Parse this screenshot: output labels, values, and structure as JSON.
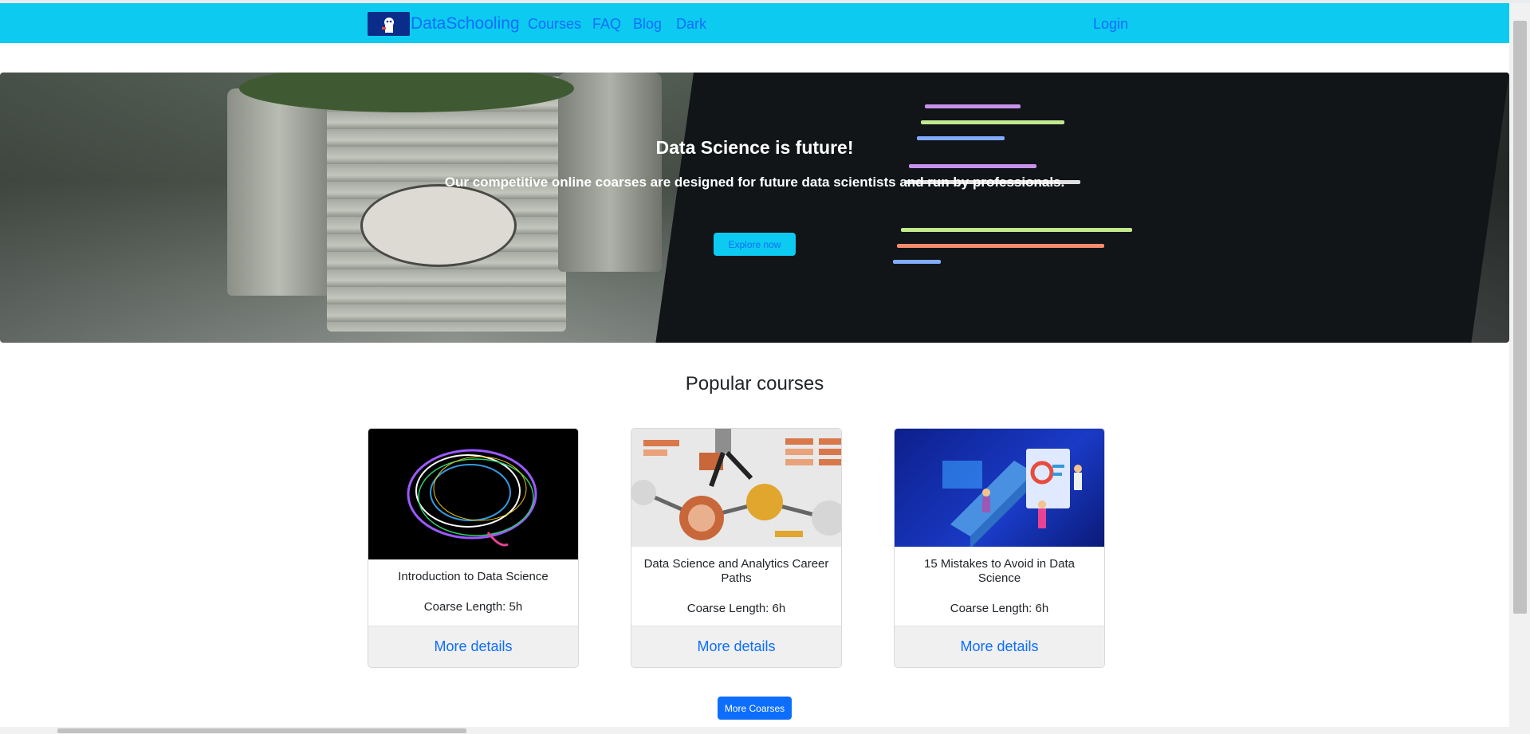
{
  "navbar": {
    "brand": "DataSchooling",
    "links": [
      "Courses",
      "FAQ",
      "Blog",
      "Dark"
    ],
    "login": "Login",
    "bg_color": "#0dcaf0",
    "link_color": "#0d6efd"
  },
  "hero": {
    "title": "Data Science is future!",
    "subtitle": "Our competitive online coarses are designed for future data scientists and run by professionals.",
    "button": "Explore now"
  },
  "popular": {
    "title": "Popular courses",
    "courses": [
      {
        "title": "Introduction to Data Science",
        "length": "Coarse Length: 5h",
        "link": "More details",
        "image": "brain-network-image"
      },
      {
        "title": "Data Science and Analytics Career Paths",
        "length": "Coarse Length: 6h",
        "link": "More details",
        "image": "career-path-illustration"
      },
      {
        "title": "15 Mistakes to Avoid in Data Science",
        "length": "Coarse Length: 6h",
        "link": "More details",
        "image": "analytics-illustration"
      }
    ],
    "more_button": "More Coarses"
  }
}
